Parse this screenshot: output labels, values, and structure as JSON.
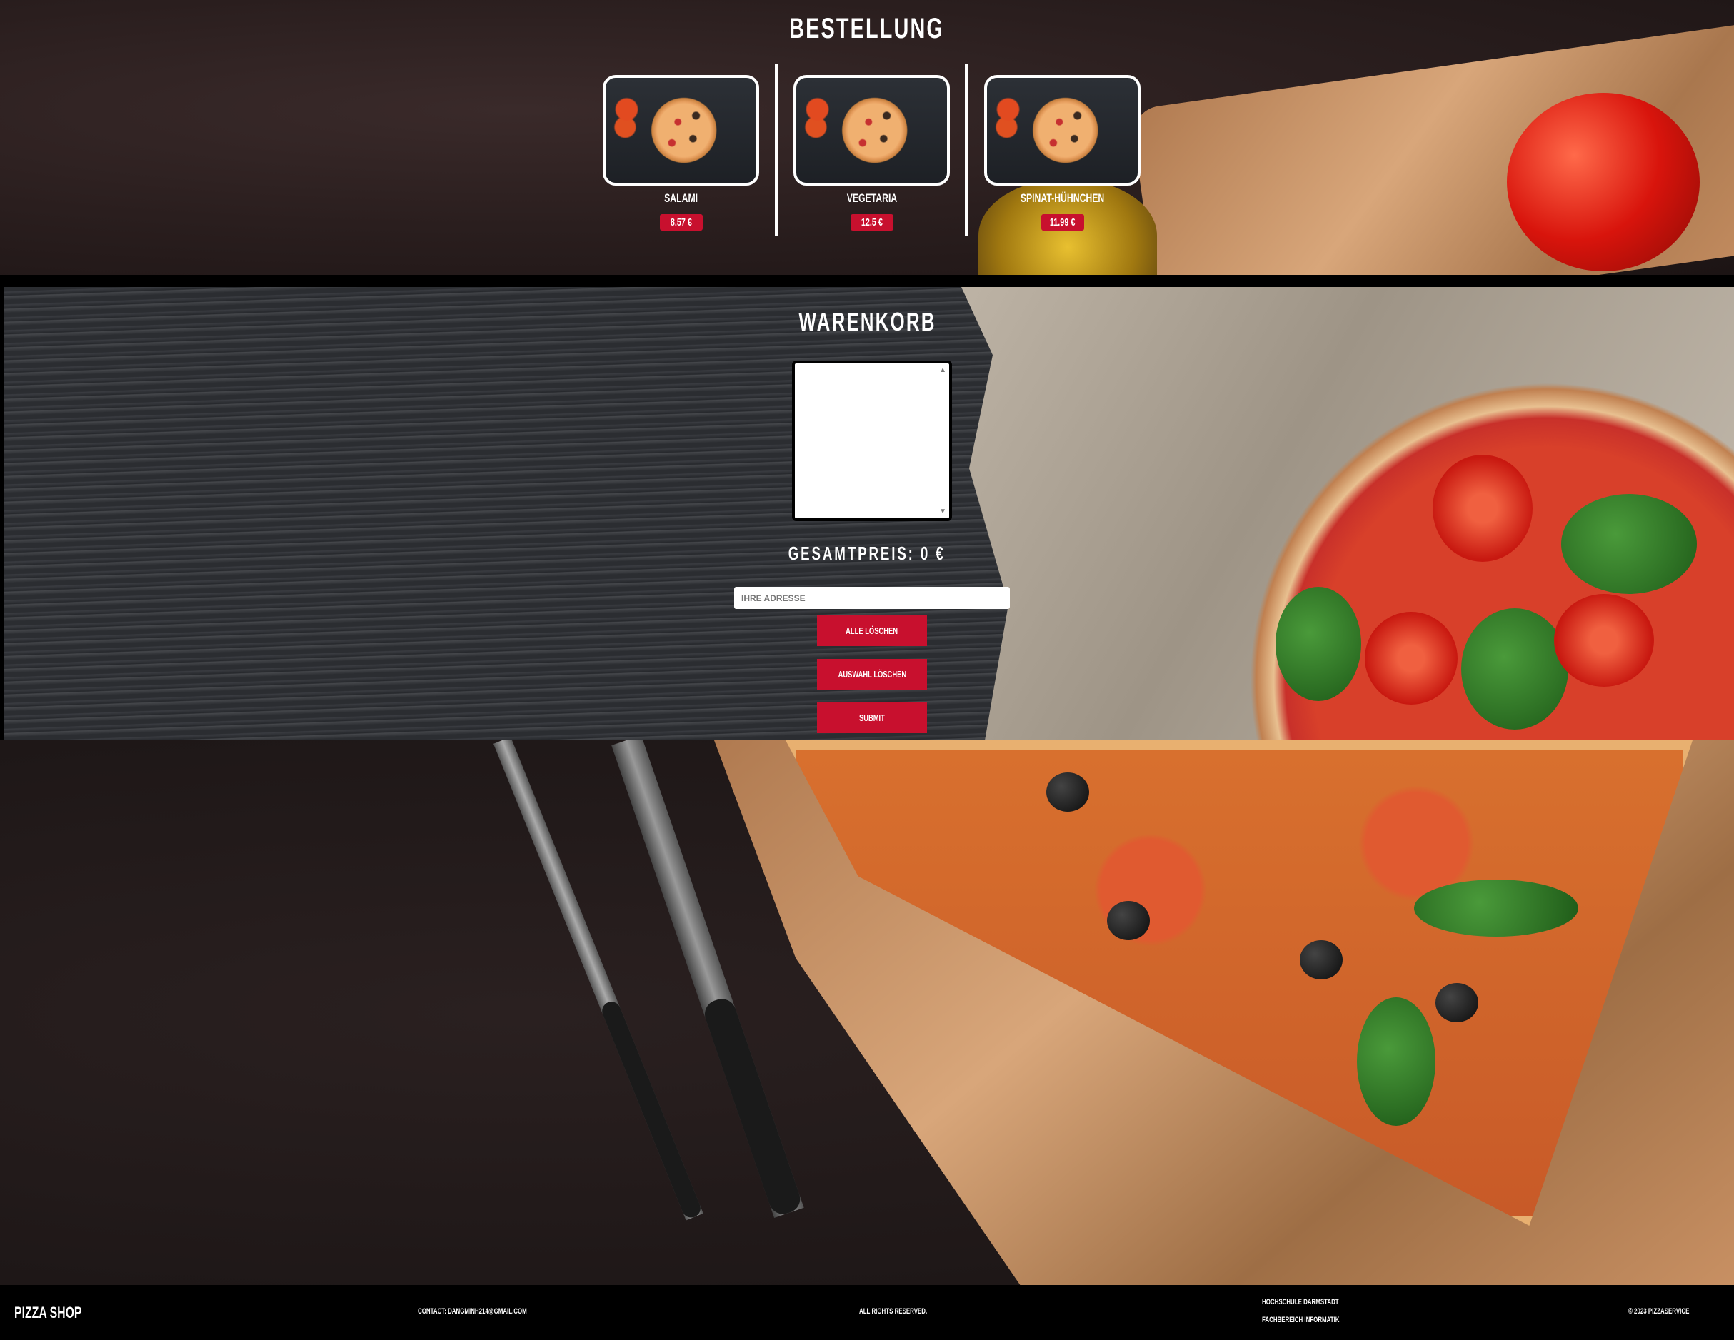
{
  "order": {
    "title": "BESTELLUNG",
    "pizzas": [
      {
        "name": "SALAMI",
        "price": "8.57 €"
      },
      {
        "name": "VEGETARIA",
        "price": "12.5 €"
      },
      {
        "name": "SPINAT-HÜHNCHEN",
        "price": "11.99 €"
      }
    ]
  },
  "cart": {
    "title": "WARENKORB",
    "total": "GESAMTPREIS: 0 €",
    "address_placeholder": "IHRE ADRESSE",
    "buttons": {
      "clear_all": "ALLE LÖSCHEN",
      "clear_selection": "AUSWAHL LÖSCHEN",
      "submit": "SUBMIT"
    }
  },
  "footer": {
    "brand": "PIZZA SHOP",
    "contact": "CONTACT: DANGMINH214@GMAIL.COM",
    "rights": "ALL RIGHTS RESERVED.",
    "school": "HOCHSCHULE DARMSTADT",
    "department": "FACHBEREICH INFORMATIK",
    "copyright": "© 2023 PIZZASERVICE"
  },
  "colors": {
    "accent": "#c8102e",
    "footer_bg": "#000000"
  }
}
